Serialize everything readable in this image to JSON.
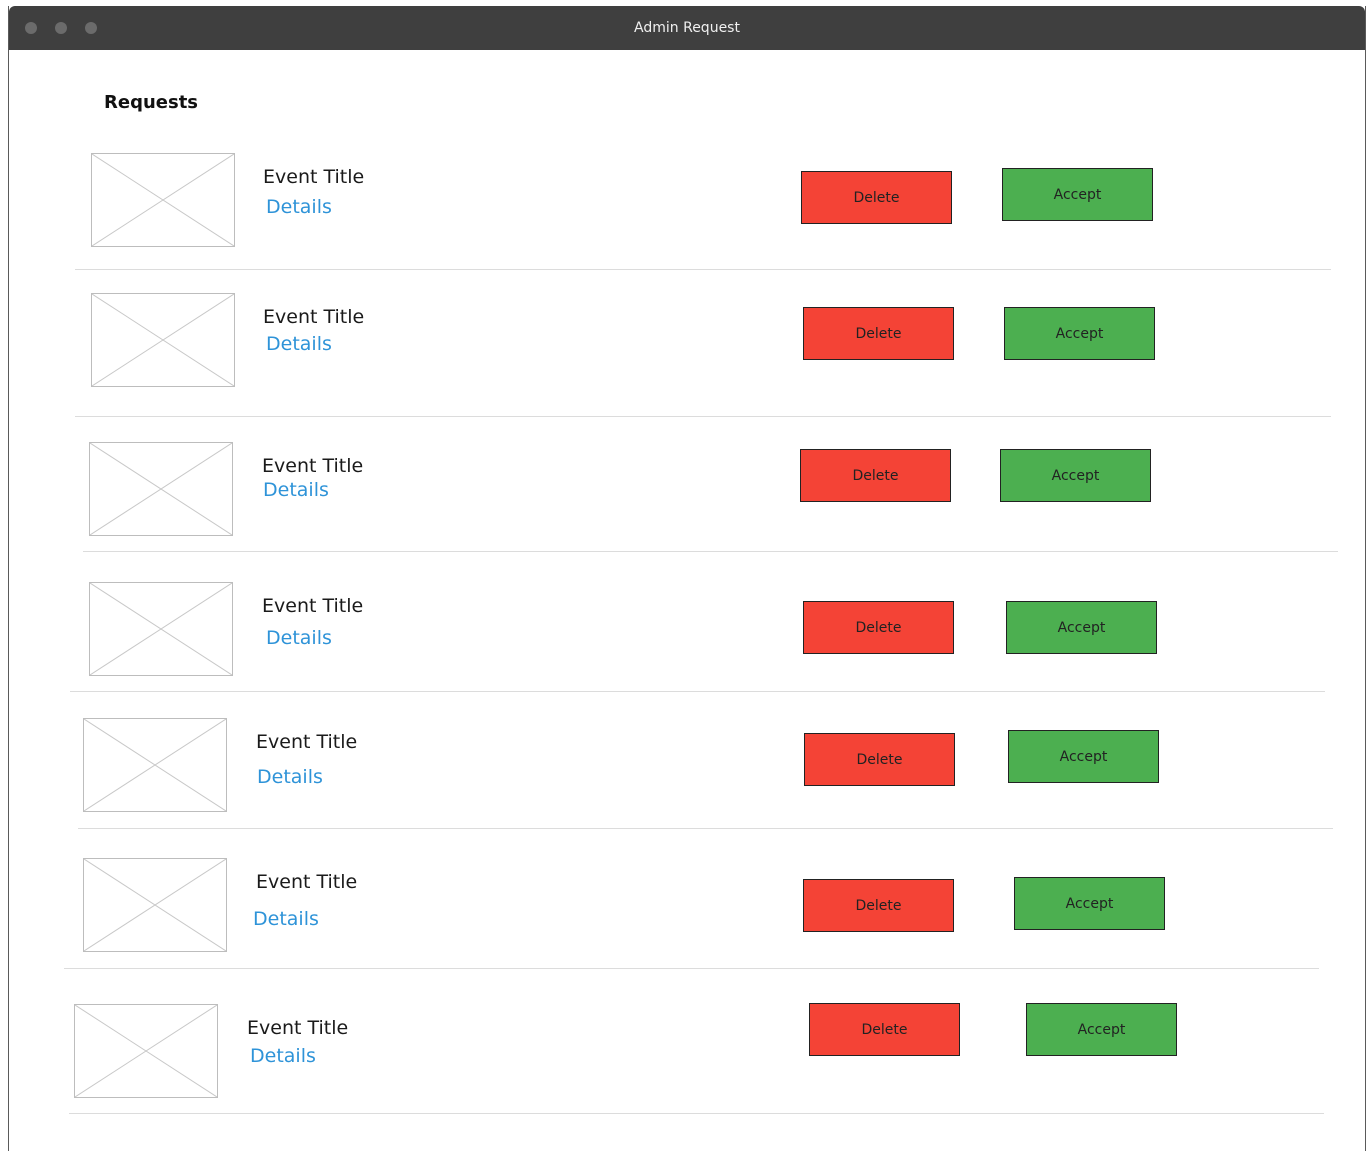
{
  "window": {
    "title": "Admin Request"
  },
  "page": {
    "heading": "Requests"
  },
  "colors": {
    "delete": "#f44336",
    "accept": "#4caf50",
    "link": "#2e93d8",
    "titlebar": "#3f3f3f"
  },
  "requests": [
    {
      "title": "Event Title",
      "details": "Details",
      "delete_label": "Delete",
      "accept_label": "Accept",
      "image_icon": "image-placeholder-icon"
    },
    {
      "title": "Event Title",
      "details": "Details",
      "delete_label": "Delete",
      "accept_label": "Accept",
      "image_icon": "image-placeholder-icon"
    },
    {
      "title": "Event Title",
      "details": "Details",
      "delete_label": "Delete",
      "accept_label": "Accept",
      "image_icon": "image-placeholder-icon"
    },
    {
      "title": "Event Title",
      "details": "Details",
      "delete_label": "Delete",
      "accept_label": "Accept",
      "image_icon": "image-placeholder-icon"
    },
    {
      "title": "Event Title",
      "details": "Details",
      "delete_label": "Delete",
      "accept_label": "Accept",
      "image_icon": "image-placeholder-icon"
    },
    {
      "title": "Event Title",
      "details": "Details",
      "delete_label": "Delete",
      "accept_label": "Accept",
      "image_icon": "image-placeholder-icon"
    },
    {
      "title": "Event Title",
      "details": "Details",
      "delete_label": "Delete",
      "accept_label": "Accept",
      "image_icon": "image-placeholder-icon"
    }
  ]
}
